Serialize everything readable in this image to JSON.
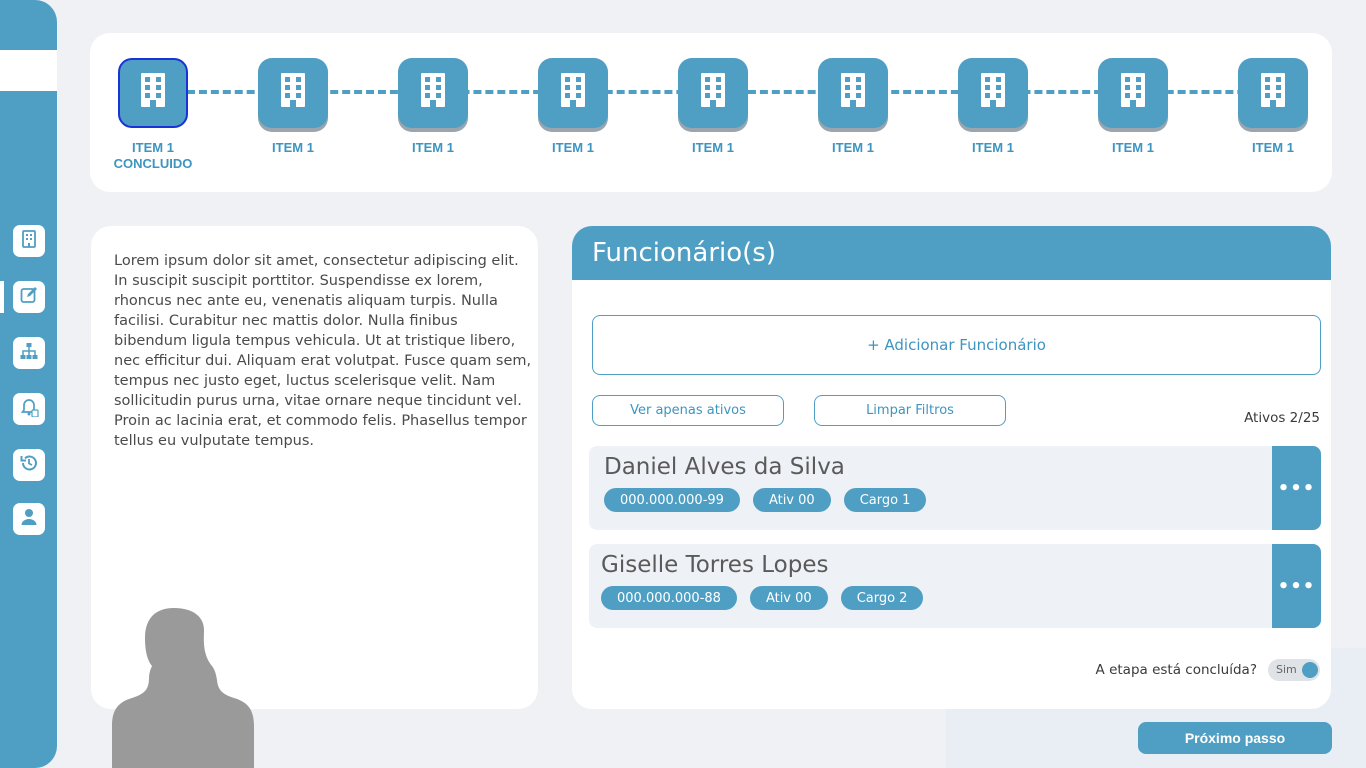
{
  "colors": {
    "accent": "#4f9fc4",
    "accent_text": "#3d95c0",
    "active_step_border": "#1a33d6",
    "background": "#eff1f4",
    "card": "#ffffff"
  },
  "sidebar": {
    "items": [
      {
        "icon": "building-icon",
        "active": false
      },
      {
        "icon": "edit-icon",
        "active": true
      },
      {
        "icon": "org-chart-icon",
        "active": false
      },
      {
        "icon": "bell-document-icon",
        "active": false
      },
      {
        "icon": "history-icon",
        "active": false
      },
      {
        "icon": "user-icon",
        "active": false
      }
    ]
  },
  "steps": [
    {
      "label": "ITEM 1",
      "sublabel": "CONCLUIDO",
      "active": true
    },
    {
      "label": "ITEM 1",
      "sublabel": "",
      "active": false
    },
    {
      "label": "ITEM 1",
      "sublabel": "",
      "active": false
    },
    {
      "label": "ITEM 1",
      "sublabel": "",
      "active": false
    },
    {
      "label": "ITEM 1",
      "sublabel": "",
      "active": false
    },
    {
      "label": "ITEM 1",
      "sublabel": "",
      "active": false
    },
    {
      "label": "ITEM 1",
      "sublabel": "",
      "active": false
    },
    {
      "label": "ITEM 1",
      "sublabel": "",
      "active": false
    },
    {
      "label": "ITEM 1",
      "sublabel": "",
      "active": false
    }
  ],
  "intro_text": "Lorem ipsum dolor sit amet, consectetur adipiscing elit. In suscipit suscipit porttitor. Suspendisse ex lorem, rhoncus nec ante eu, venenatis aliquam turpis. Nulla facilisi. Curabitur nec mattis dolor. Nulla finibus bibendum ligula tempus vehicula. Ut at tristique libero, nec efficitur dui. Aliquam erat volutpat. Fusce quam sem, tempus nec justo eget, luctus scelerisque velit. Nam sollicitudin purus urna, vitae ornare neque tincidunt vel. Proin ac lacinia erat, et commodo felis. Phasellus tempor tellus eu vulputate tempus.",
  "employees_panel": {
    "title": "Funcionário(s)",
    "add_label": "+ Adicionar Funcionário",
    "filter_active_label": "Ver apenas ativos",
    "clear_filters_label": "Limpar Filtros",
    "active_count": "Ativos 2/25",
    "employees": [
      {
        "name": "Daniel Alves da Silva",
        "cpf": "000.000.000-99",
        "activity": "Ativ 00",
        "role": "Cargo 1",
        "more_label": "•••"
      },
      {
        "name": "Giselle Torres Lopes",
        "cpf": "000.000.000-88",
        "activity": "Ativ 00",
        "role": "Cargo 2",
        "more_label": "•••"
      }
    ],
    "step_done_question": "A etapa está concluída?",
    "toggle_label": "Sim",
    "toggle_on": true
  },
  "next_button_label": "Próximo passo"
}
